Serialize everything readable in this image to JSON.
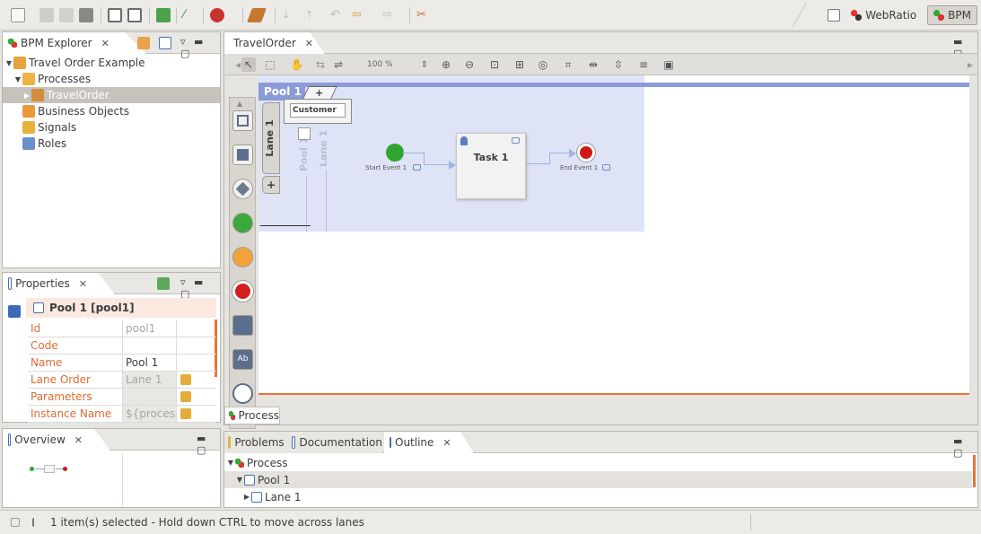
{
  "toolbar": {
    "perspectives": [
      {
        "label": "WebRatio",
        "active": false
      },
      {
        "label": "BPM",
        "active": true
      }
    ]
  },
  "explorer": {
    "title": "BPM Explorer",
    "tree": [
      {
        "label": "Travel Order Example",
        "expanded": true
      },
      {
        "label": "Processes",
        "expanded": true
      },
      {
        "label": "TravelOrder",
        "selected": true
      },
      {
        "label": "Business Objects"
      },
      {
        "label": "Signals"
      },
      {
        "label": "Roles"
      }
    ]
  },
  "properties": {
    "title": "Properties",
    "header": "Pool 1 [pool1]",
    "rows": [
      {
        "key": "Id",
        "value": "pool1"
      },
      {
        "key": "Code",
        "value": ""
      },
      {
        "key": "Name",
        "value": "Pool 1"
      },
      {
        "key": "Lane Order",
        "value": "Lane 1"
      },
      {
        "key": "Parameters",
        "value": ""
      },
      {
        "key": "Instance Name",
        "value": "${processI"
      }
    ]
  },
  "overview": {
    "title": "Overview"
  },
  "editor": {
    "tab": "TravelOrder",
    "zoom": "100 %",
    "bottom_tab": "Process",
    "pool_label": "Pool 1",
    "pool_add": "+",
    "lane_label": "Lane 1",
    "lane_add": "+",
    "ghost_pool": "Pool 1",
    "ghost_lane": "Lane 1",
    "customer_input": "Customer",
    "start_event": "Start Event 1",
    "task": "Task 1",
    "end_event": "End Event 1",
    "colors": {
      "pool_bg": "#dfe3f6",
      "pool_bar": "#8a9bd8",
      "start": "#2fa52f",
      "end": "#d01818",
      "accent": "#e8733a"
    }
  },
  "bottom_panel": {
    "tabs": [
      {
        "label": "Problems",
        "active": false
      },
      {
        "label": "Documentation",
        "active": false
      },
      {
        "label": "Outline",
        "active": true
      }
    ],
    "outline": [
      {
        "label": "Process",
        "level": 0
      },
      {
        "label": "Pool 1",
        "level": 1,
        "selected": true
      },
      {
        "label": "Lane 1",
        "level": 2
      }
    ]
  },
  "status": {
    "message": "1 item(s) selected - Hold down CTRL to move across lanes"
  }
}
